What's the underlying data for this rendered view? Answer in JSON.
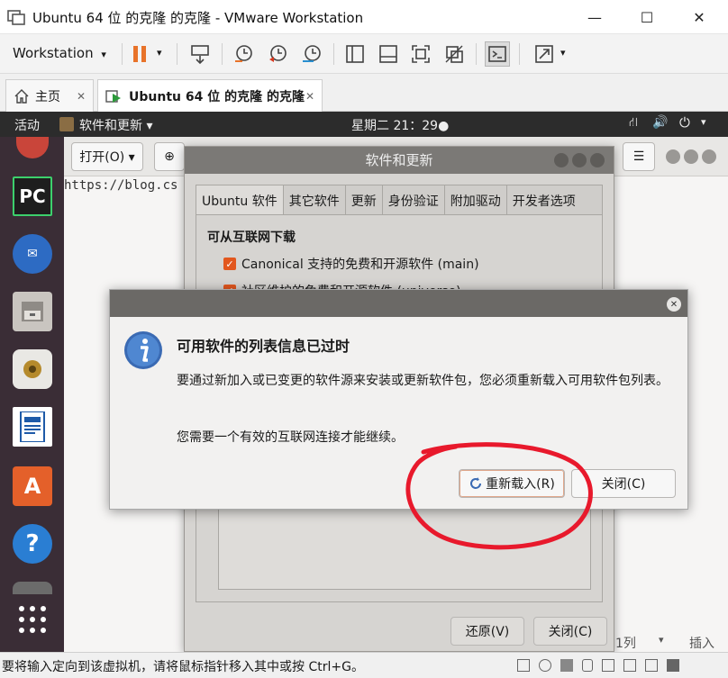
{
  "window": {
    "title": "Ubuntu 64 位 的克隆 的克隆 - VMware Workstation",
    "controls": [
      "—",
      "☐",
      "✕"
    ]
  },
  "toolbar": {
    "menu_label": "Workstation",
    "menu_arrow": "▾"
  },
  "tabs": [
    {
      "label": "主页",
      "close": "✕"
    },
    {
      "label": "Ubuntu 64 位 的克隆 的克隆",
      "close": "✕"
    }
  ],
  "ubuntu_topbar": {
    "activities": "活动",
    "app_menu": "软件和更新 ▾",
    "clock": "星期二 21：29●"
  },
  "background_window": {
    "open_button": "打开(O) ▾",
    "url_text": "https://blog.cs",
    "status_col": "1列",
    "status_insert": "插入"
  },
  "sw_updates": {
    "title": "软件和更新",
    "tabs": [
      "Ubuntu 软件",
      "其它软件",
      "更新",
      "身份验证",
      "附加驱动",
      "开发者选项"
    ],
    "section_title": "可从互联网下载",
    "checkbox_1": "Canonical 支持的免费和开源软件 (main)",
    "checkbox_2": "社区维护的免费和开源软件 (universe)",
    "revert_button": "还原(V)",
    "close_button": "关闭(C)"
  },
  "dialog": {
    "heading": "可用软件的列表信息已过时",
    "body": "要通过新加入或已变更的软件源来安装或更新软件包，您必须重新载入可用软件包列表。",
    "note": "您需要一个有效的互联网连接才能继续。",
    "reload_button": "重新载入(R)",
    "close_button": "关闭(C)",
    "close_x": "✕"
  },
  "statusbar": {
    "message": "要将输入定向到该虚拟机，请将鼠标指针移入其中或按 Ctrl+G。"
  },
  "colors": {
    "accent_orange": "#e2571e",
    "dock_bg": "#3a2d36",
    "annotation_red": "#e8192c"
  }
}
